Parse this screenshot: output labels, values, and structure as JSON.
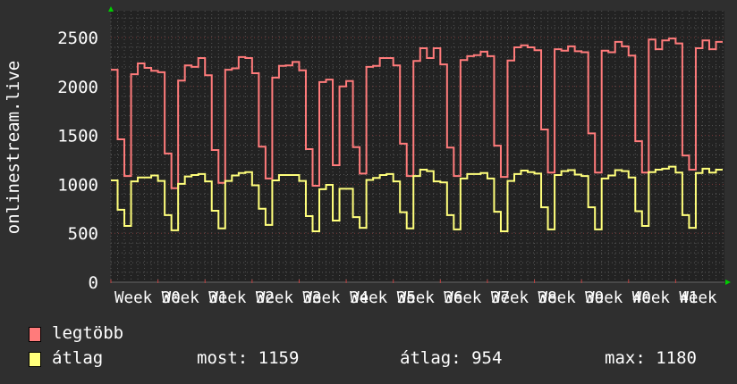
{
  "chart_data": {
    "type": "line",
    "ylabel": "onlinestream.live",
    "ylim": [
      0,
      2750
    ],
    "yticks": [
      "0",
      "500",
      "1000",
      "1500",
      "2000",
      "2500"
    ],
    "ytick_values": [
      0,
      500,
      1000,
      1500,
      2000,
      2500
    ],
    "xticks": [
      "Week 30",
      "Week 31",
      "Week 32",
      "Week 33",
      "Week 34",
      "Week 35",
      "Week 36",
      "Week 37",
      "Week 38",
      "Week 39",
      "Week 40",
      "Week 41",
      "Week"
    ],
    "grid": true,
    "x_unit": "day",
    "series": [
      {
        "name": "legtöbb",
        "color": "#ff7b7b",
        "values": [
          2170,
          1460,
          1085,
          2125,
          2235,
          2190,
          2160,
          2145,
          1315,
          960,
          2060,
          2215,
          2200,
          2290,
          2115,
          1350,
          1015,
          2170,
          2185,
          2300,
          2290,
          2135,
          1385,
          1060,
          2090,
          2210,
          2215,
          2250,
          2165,
          1360,
          985,
          2045,
          2070,
          1195,
          2000,
          2055,
          1380,
          1110,
          2200,
          2210,
          2290,
          2290,
          2215,
          1415,
          1085,
          2260,
          2390,
          2290,
          2390,
          2225,
          1375,
          1085,
          2270,
          2310,
          2320,
          2355,
          2310,
          1395,
          1075,
          2265,
          2400,
          2420,
          2400,
          2370,
          1560,
          1120,
          2380,
          2365,
          2410,
          2360,
          2350,
          1520,
          1120,
          2365,
          2350,
          2455,
          2410,
          2315,
          1440,
          1120,
          2480,
          2380,
          2470,
          2490,
          2440,
          1295,
          1150,
          2390,
          2470,
          2380,
          2455
        ]
      },
      {
        "name": "átlag",
        "color": "#ffff7b",
        "values": [
          1040,
          740,
          575,
          1030,
          1070,
          1070,
          1090,
          1035,
          685,
          530,
          1005,
          1080,
          1095,
          1105,
          1030,
          730,
          550,
          1035,
          1090,
          1115,
          1125,
          990,
          750,
          585,
          1040,
          1095,
          1095,
          1095,
          1035,
          675,
          520,
          950,
          995,
          630,
          955,
          955,
          665,
          555,
          1045,
          1065,
          1095,
          1105,
          1030,
          715,
          550,
          1085,
          1150,
          1135,
          1030,
          1020,
          685,
          540,
          1060,
          1105,
          1105,
          1115,
          1060,
          720,
          520,
          1035,
          1105,
          1140,
          1125,
          1110,
          765,
          540,
          1095,
          1135,
          1145,
          1100,
          1085,
          765,
          540,
          1060,
          1090,
          1145,
          1135,
          1070,
          725,
          575,
          1125,
          1150,
          1160,
          1180,
          1120,
          685,
          555,
          1115,
          1160,
          1120,
          1150
        ]
      }
    ]
  },
  "legend": {
    "items": [
      {
        "label": "legtöbb",
        "color": "#ff7b7b"
      },
      {
        "label": "átlag",
        "color": "#ffff7b"
      }
    ],
    "stats": {
      "most": "most: 1159",
      "atlag": "átlag: 954",
      "max": "max: 1180"
    }
  }
}
